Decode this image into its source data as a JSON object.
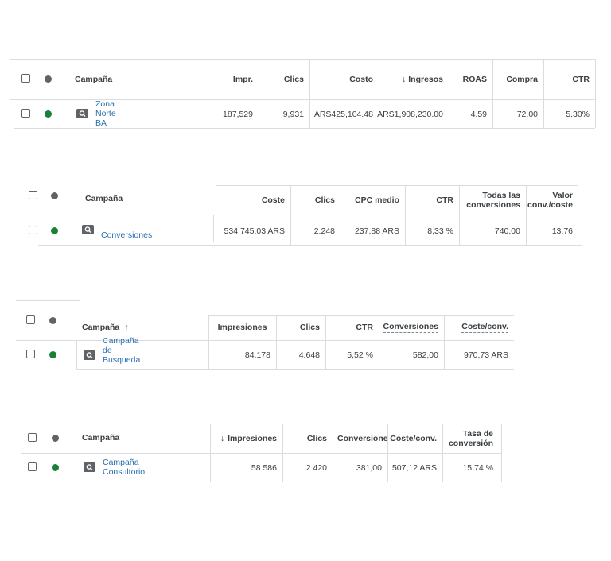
{
  "table1": {
    "headers": {
      "campaign": "Campaña",
      "impr": "Impr.",
      "clicks": "Clics",
      "cost": "Costo",
      "revenue": "Ingresos",
      "roas": "ROAS",
      "purchase": "Compra",
      "ctr": "CTR"
    },
    "row": {
      "campaign_line1": "Zona",
      "campaign_line2": "Norte BA",
      "impr": "187,529",
      "clicks": "9,931",
      "cost": "ARS425,104.48",
      "revenue": "ARS1,908,230.00",
      "roas": "4.59",
      "purchase": "72.00",
      "ctr": "5.30%"
    }
  },
  "table2": {
    "headers": {
      "campaign": "Campaña",
      "cost": "Coste",
      "clicks": "Clics",
      "cpc": "CPC medio",
      "ctr": "CTR",
      "all_conv_1": "Todas las",
      "all_conv_2": "conversiones",
      "value_1": "Valor",
      "value_2": "conv./coste"
    },
    "row": {
      "campaign": "Conversiones",
      "cost": "534.745,03 ARS",
      "clicks": "2.248",
      "cpc": "237,88 ARS",
      "ctr": "8,33 %",
      "all_conv": "740,00",
      "value": "13,76"
    }
  },
  "table3": {
    "headers": {
      "campaign": "Campaña",
      "impressions": "Impresiones",
      "clicks": "Clics",
      "ctr": "CTR",
      "conversions": "Conversiones",
      "cost_conv": "Coste/conv."
    },
    "row": {
      "campaign_line1": "Campaña de",
      "campaign_line2": "Busqueda",
      "impressions": "84.178",
      "clicks": "4.648",
      "ctr": "5,52 %",
      "conversions": "582,00",
      "cost_conv": "970,73 ARS"
    }
  },
  "table4": {
    "headers": {
      "campaign": "Campaña",
      "impressions": "Impresiones",
      "clicks": "Clics",
      "conversions": "Conversiones",
      "cost_conv": "Coste/conv.",
      "rate_1": "Tasa de",
      "rate_2": "conversión"
    },
    "row": {
      "campaign": "Campaña Consultorio",
      "impressions": "58.586",
      "clicks": "2.420",
      "conversions": "381,00",
      "cost_conv": "507,12 ARS",
      "rate": "15,74 %"
    }
  }
}
